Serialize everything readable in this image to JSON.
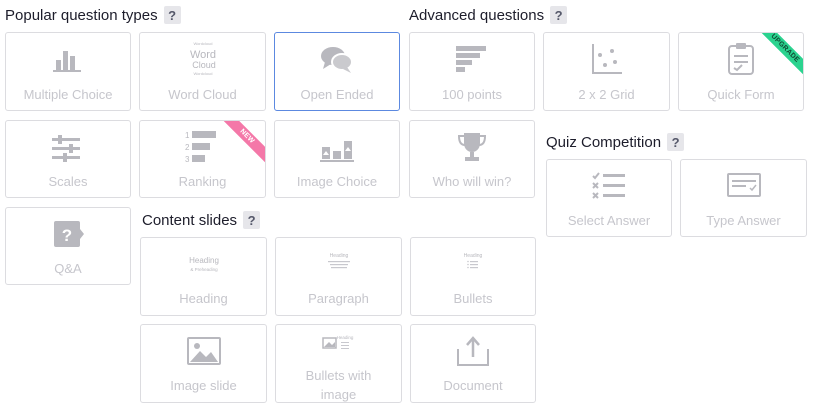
{
  "sections": {
    "popular": {
      "title": "Popular question types",
      "help": "?"
    },
    "advanced": {
      "title": "Advanced questions",
      "help": "?"
    },
    "quiz": {
      "title": "Quiz Competition",
      "help": "?"
    },
    "content": {
      "title": "Content slides",
      "help": "?"
    }
  },
  "cards": {
    "multiple_choice": {
      "label": "Multiple Choice",
      "icon": "bar-chart-icon"
    },
    "word_cloud": {
      "label": "Word Cloud",
      "icon": "word-cloud-icon",
      "icon_words": {
        "line1": "Wordcloud",
        "big1": "Word",
        "big2": "Cloud",
        "line3": "Wordcloud"
      }
    },
    "open_ended": {
      "label": "Open Ended",
      "icon": "speech-bubbles-icon",
      "selected": true
    },
    "points_100": {
      "label": "100 points",
      "icon": "horizontal-bars-icon"
    },
    "grid_2x2": {
      "label": "2 x 2 Grid",
      "icon": "scatter-grid-icon"
    },
    "quick_form": {
      "label": "Quick Form",
      "icon": "clipboard-icon",
      "ribbon": "UPGRADE"
    },
    "scales": {
      "label": "Scales",
      "icon": "sliders-icon"
    },
    "ranking": {
      "label": "Ranking",
      "icon": "ranking-icon",
      "ribbon": "NEW",
      "icon_numbers": [
        "1",
        "2",
        "3"
      ]
    },
    "image_choice": {
      "label": "Image Choice",
      "icon": "image-bars-icon"
    },
    "who_will_win": {
      "label": "Who will win?",
      "icon": "trophy-icon"
    },
    "select_answer": {
      "label": "Select Answer",
      "icon": "checklist-icon"
    },
    "type_answer": {
      "label": "Type Answer",
      "icon": "text-input-icon"
    },
    "qa": {
      "label": "Q&A",
      "icon": "question-bubble-icon",
      "icon_char": "?"
    },
    "heading": {
      "label": "Heading",
      "icon": "heading-preview-icon",
      "icon_title": "Heading",
      "icon_sub": "& Preheading"
    },
    "paragraph": {
      "label": "Paragraph",
      "icon": "paragraph-preview-icon",
      "icon_title": "Heading"
    },
    "bullets": {
      "label": "Bullets",
      "icon": "bullets-preview-icon",
      "icon_title": "Heading"
    },
    "image_slide": {
      "label": "Image slide",
      "icon": "image-icon"
    },
    "bullets_with_image": {
      "label": "Bullets with\nimage",
      "label_line1": "Bullets with",
      "label_line2": "image",
      "icon": "image-bullets-icon",
      "icon_title": "Heading"
    },
    "document": {
      "label": "Document",
      "icon": "document-upload-icon"
    }
  },
  "colors": {
    "icon": "#b8b8be",
    "label": "#c6c6cc",
    "selected_border": "#5c89e0",
    "new_ribbon": "#f478a8",
    "upgrade_ribbon": "#2bd38f"
  }
}
